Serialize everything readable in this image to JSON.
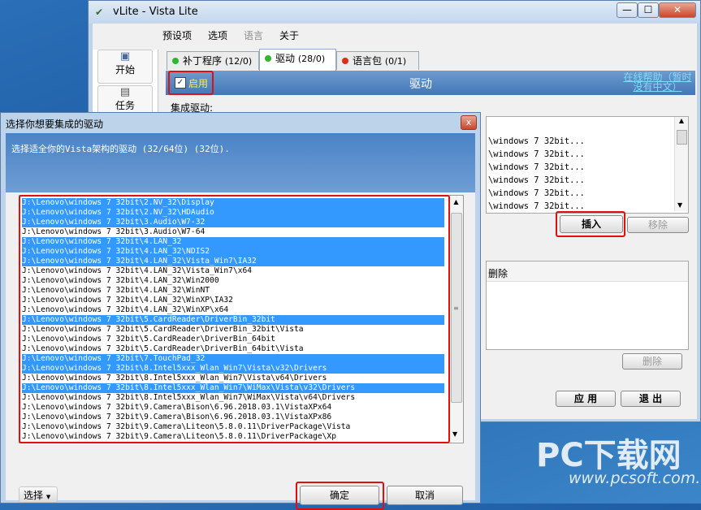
{
  "main_window": {
    "title": "vLite - Vista Lite",
    "title_buttons": [
      "—",
      "☐",
      "✕"
    ],
    "menu": [
      "预设项",
      "选项",
      "语言",
      "关于"
    ],
    "left_buttons": [
      "开始",
      "任务"
    ],
    "tabs": [
      {
        "label": "补丁程序",
        "count": "(12/0)",
        "dot": "#2fb52f"
      },
      {
        "label": "驱动",
        "count": "(28/0)",
        "dot": "#2fb52f"
      },
      {
        "label": "语言包",
        "count": "(0/1)",
        "dot": "#e02a1a"
      }
    ],
    "enable_label": "启用",
    "section_title": "驱动",
    "help_link": "在线帮助（暂时没有中文）",
    "integrate_label": "集成驱动:",
    "right_list": [
      "\\windows 7 32bit...",
      "\\windows 7 32bit...",
      "\\windows 7 32bit...",
      "\\windows 7 32bit...",
      "\\windows 7 32bit...",
      "\\windows 7 32bit..."
    ],
    "insert_button": "插入",
    "remove_button": "移除",
    "delete_label": "删除",
    "delete_button": "删除",
    "apply_button": "应  用",
    "exit_button": "退  出",
    "accent_red": "#e01010"
  },
  "dialog": {
    "title": "选择你想要集成的驱动",
    "close_glyph": "x",
    "banner_text": "选择适全你的Vista架构的驱动 (32/64位) (32位).",
    "items": [
      {
        "path": "J:\\Lenovo\\windows 7 32bit\\2.NV_32\\Display",
        "selected": true
      },
      {
        "path": "J:\\Lenovo\\windows 7 32bit\\2.NV_32\\HDAudio",
        "selected": true
      },
      {
        "path": "J:\\Lenovo\\windows 7 32bit\\3.Audio\\W7-32",
        "selected": true
      },
      {
        "path": "J:\\Lenovo\\windows 7 32bit\\3.Audio\\W7-64",
        "selected": false
      },
      {
        "path": "J:\\Lenovo\\windows 7 32bit\\4.LAN_32",
        "selected": true
      },
      {
        "path": "J:\\Lenovo\\windows 7 32bit\\4.LAN_32\\NDIS2",
        "selected": true
      },
      {
        "path": "J:\\Lenovo\\windows 7 32bit\\4.LAN_32\\Vista_Win7\\IA32",
        "selected": true
      },
      {
        "path": "J:\\Lenovo\\windows 7 32bit\\4.LAN_32\\Vista_Win7\\x64",
        "selected": false
      },
      {
        "path": "J:\\Lenovo\\windows 7 32bit\\4.LAN_32\\Win2000",
        "selected": false
      },
      {
        "path": "J:\\Lenovo\\windows 7 32bit\\4.LAN_32\\WinNT",
        "selected": false
      },
      {
        "path": "J:\\Lenovo\\windows 7 32bit\\4.LAN_32\\WinXP\\IA32",
        "selected": false
      },
      {
        "path": "J:\\Lenovo\\windows 7 32bit\\4.LAN_32\\WinXP\\x64",
        "selected": false
      },
      {
        "path": "J:\\Lenovo\\windows 7 32bit\\5.CardReader\\DriverBin_32bit",
        "selected": true
      },
      {
        "path": "J:\\Lenovo\\windows 7 32bit\\5.CardReader\\DriverBin_32bit\\Vista",
        "selected": false
      },
      {
        "path": "J:\\Lenovo\\windows 7 32bit\\5.CardReader\\DriverBin_64bit",
        "selected": false
      },
      {
        "path": "J:\\Lenovo\\windows 7 32bit\\5.CardReader\\DriverBin_64bit\\Vista",
        "selected": false
      },
      {
        "path": "J:\\Lenovo\\windows 7 32bit\\7.TouchPad_32",
        "selected": true
      },
      {
        "path": "J:\\Lenovo\\windows 7 32bit\\8.Intel5xxx_Wlan_Win7\\Vista\\v32\\Drivers",
        "selected": true
      },
      {
        "path": "J:\\Lenovo\\windows 7 32bit\\8.Intel5xxx_Wlan_Win7\\Vista\\v64\\Drivers",
        "selected": false
      },
      {
        "path": "J:\\Lenovo\\windows 7 32bit\\8.Intel5xxx_Wlan_Win7\\WiMax\\Vista\\v32\\Drivers",
        "selected": true
      },
      {
        "path": "J:\\Lenovo\\windows 7 32bit\\8.Intel5xxx_Wlan_Win7\\WiMax\\Vista\\v64\\Drivers",
        "selected": false
      },
      {
        "path": "J:\\Lenovo\\windows 7 32bit\\9.Camera\\Bison\\6.96.2018.03.1\\VistaXPx64",
        "selected": false
      },
      {
        "path": "J:\\Lenovo\\windows 7 32bit\\9.Camera\\Bison\\6.96.2018.03.1\\VistaXPx86",
        "selected": false
      },
      {
        "path": "J:\\Lenovo\\windows 7 32bit\\9.Camera\\Liteon\\5.8.0.11\\DriverPackage\\Vista",
        "selected": false
      },
      {
        "path": "J:\\Lenovo\\windows 7 32bit\\9.Camera\\Liteon\\5.8.0.11\\DriverPackage\\Xp",
        "selected": false
      }
    ],
    "select_button": "选择",
    "ok_button": "确定",
    "cancel_button": "取消",
    "selection_color": "#3399ff"
  },
  "watermark": {
    "logo": "PC下载网",
    "url": "www.pcsoft.com.cn"
  }
}
